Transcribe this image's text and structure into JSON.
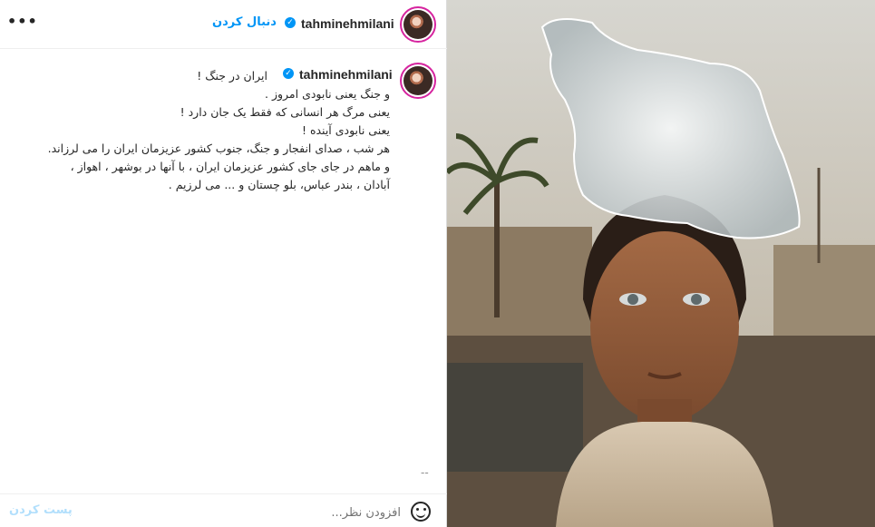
{
  "header": {
    "more_label": "•••",
    "username": "tahminehmilani",
    "verified_mark": "✓",
    "follow_label": "دنبال کردن"
  },
  "post": {
    "username": "tahminehmilani",
    "verified_mark": "✓",
    "caption_lines": [
      "ایران در جنگ !",
      "و جنگ یعنی نابودی امروز .",
      "یعنی مرگ هر انسانی که فقط یک جان دارد !",
      "یعنی نابودی آینده !",
      "هر شب ، صدای انفجار و جنگ، جنوب کشور عزیزمان ایران را می لرزاند.",
      "و ماهم در جای جای کشور عزیزمان ایران ، با آنها در بوشهر ، اهواز ،",
      "آبادان ، بندر عباس، بلو چستان و ... می لرزیم ."
    ],
    "more_dash": "--"
  },
  "footer": {
    "emoji_icon": "smiley-icon",
    "comment_placeholder": "افزودن نظر...",
    "post_label": "پست کردن"
  },
  "colors": {
    "accent": "#0095f6",
    "post_disabled": "#b2dffc",
    "text": "#262626"
  }
}
